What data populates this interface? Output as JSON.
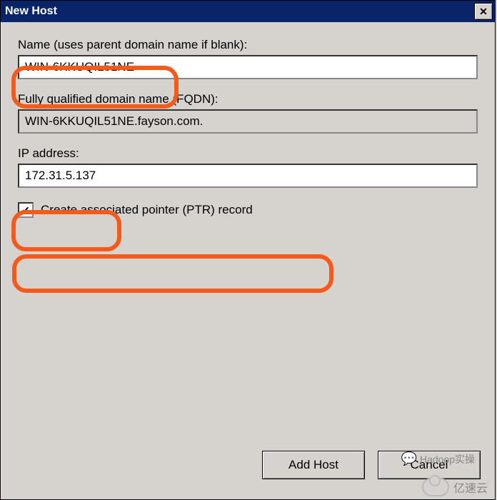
{
  "window": {
    "title": "New Host"
  },
  "labels": {
    "name": "Name (uses parent domain name if blank):",
    "fqdn": "Fully qualified domain name (FQDN):",
    "ip": "IP address:",
    "ptr": "Create associated pointer (PTR) record"
  },
  "values": {
    "name": "WIN-6KKUQIL51NE",
    "fqdn": "WIN-6KKUQIL51NE.fayson.com.",
    "ip": "172.31.5.137",
    "ptr_checked": "✔"
  },
  "buttons": {
    "add": "Add Host",
    "cancel": "Cancel",
    "close_glyph": "✕"
  },
  "watermarks": {
    "top": "Hadoop实操",
    "bottom": "亿速云"
  }
}
